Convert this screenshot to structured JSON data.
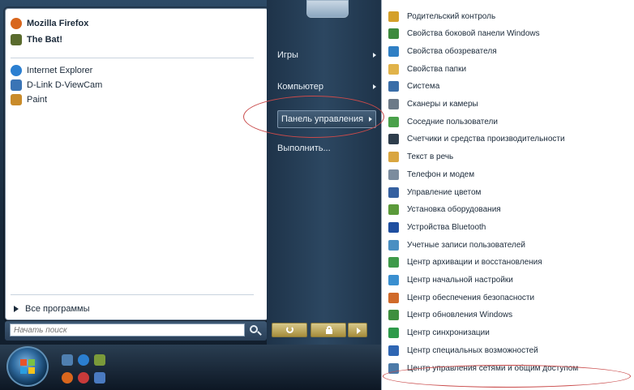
{
  "start_menu": {
    "pinned": [
      {
        "label": "Mozilla Firefox",
        "icon": "firefox-icon",
        "color": "#d8661d"
      },
      {
        "label": "The Bat!",
        "icon": "the-bat-icon",
        "color": "#5a6b2e"
      }
    ],
    "recent": [
      {
        "label": "Internet Explorer",
        "icon": "internet-explorer-icon",
        "color": "#2b7fd1"
      },
      {
        "label": "D-Link D-ViewCam",
        "icon": "dlink-viewcam-icon",
        "color": "#3a74b5"
      },
      {
        "label": "Paint",
        "icon": "paint-icon",
        "color": "#c98b2a"
      }
    ],
    "all_programs": "Все программы",
    "search_placeholder": "Начать поиск",
    "right_items": [
      {
        "label": "Игры",
        "has_arrow": true
      },
      {
        "label": "Компьютер",
        "has_arrow": true
      },
      {
        "label": "Панель управления",
        "has_arrow": true,
        "selected": true
      },
      {
        "label": "Выполнить...",
        "has_arrow": false
      }
    ]
  },
  "control_panel_submenu": [
    {
      "label": "Родительский контроль",
      "icon": "parental-control-icon",
      "color": "#d4a02a"
    },
    {
      "label": "Свойства боковой панели Windows",
      "icon": "sidebar-icon",
      "color": "#3d8a3d"
    },
    {
      "label": "Свойства обозревателя",
      "icon": "internet-options-icon",
      "color": "#2f7fc4"
    },
    {
      "label": "Свойства папки",
      "icon": "folder-options-icon",
      "color": "#e1b34a"
    },
    {
      "label": "Система",
      "icon": "system-icon",
      "color": "#3a6ea8"
    },
    {
      "label": "Сканеры и камеры",
      "icon": "scanner-icon",
      "color": "#6c7a88"
    },
    {
      "label": "Соседние пользователи",
      "icon": "people-near-me-icon",
      "color": "#4aa14a"
    },
    {
      "label": "Счетчики и средства производительности",
      "icon": "performance-icon",
      "color": "#2e3d4c"
    },
    {
      "label": "Текст в речь",
      "icon": "speech-icon",
      "color": "#d9a640"
    },
    {
      "label": "Телефон и модем",
      "icon": "phone-modem-icon",
      "color": "#7b8c9e"
    },
    {
      "label": "Управление цветом",
      "icon": "color-management-icon",
      "color": "#3560a0"
    },
    {
      "label": "Установка оборудования",
      "icon": "add-hardware-icon",
      "color": "#5b9a3a"
    },
    {
      "label": "Устройства Bluetooth",
      "icon": "bluetooth-icon",
      "color": "#1f4fa0"
    },
    {
      "label": "Учетные записи пользователей",
      "icon": "user-accounts-icon",
      "color": "#4a8fc2"
    },
    {
      "label": "Центр архивации и восстановления",
      "icon": "backup-icon",
      "color": "#3e9a4a"
    },
    {
      "label": "Центр начальной настройки",
      "icon": "welcome-center-icon",
      "color": "#3a8fd0"
    },
    {
      "label": "Центр обеспечения безопасности",
      "icon": "security-center-icon",
      "color": "#d06a2a"
    },
    {
      "label": "Центр обновления Windows",
      "icon": "windows-update-icon",
      "color": "#3f8f3f"
    },
    {
      "label": "Центр синхронизации",
      "icon": "sync-center-icon",
      "color": "#2e9a4a"
    },
    {
      "label": "Центр специальных возможностей",
      "icon": "accessibility-icon",
      "color": "#2f66b3"
    },
    {
      "label": "Центр управления сетями и общим доступом",
      "icon": "network-center-icon",
      "color": "#4c7aa8"
    }
  ],
  "colors": {
    "highlight_ellipse": "#c94a4a",
    "right_panel": "#2c4761",
    "taskbar": "#0d1724"
  }
}
